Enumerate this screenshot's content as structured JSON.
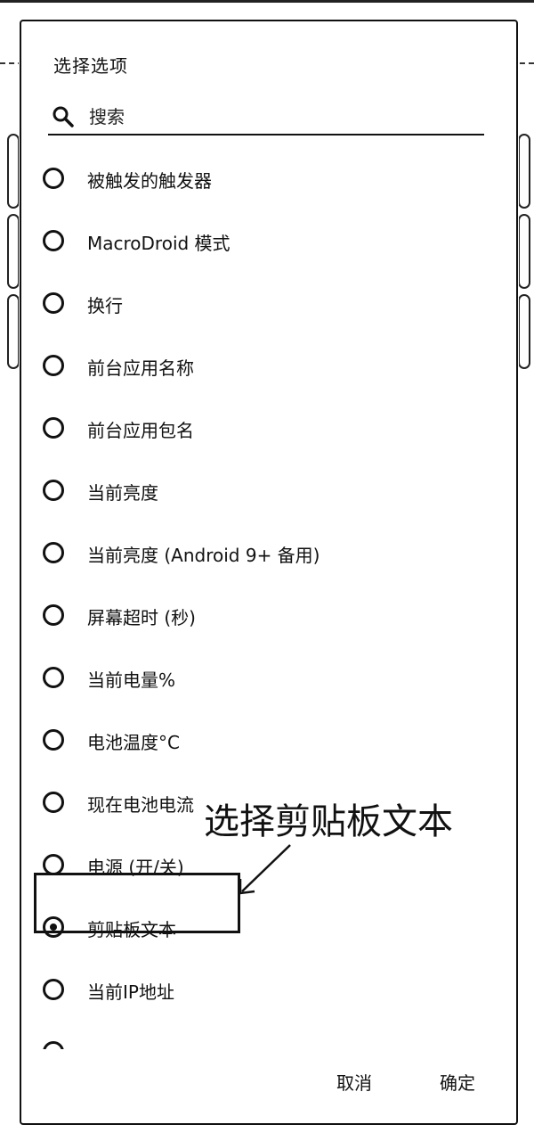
{
  "dialog": {
    "title": "选择选项",
    "search_placeholder": "搜索"
  },
  "options": [
    {
      "label": "被触发的触发器",
      "selected": false
    },
    {
      "label": "MacroDroid 模式",
      "selected": false
    },
    {
      "label": "换行",
      "selected": false
    },
    {
      "label": "前台应用名称",
      "selected": false
    },
    {
      "label": "前台应用包名",
      "selected": false
    },
    {
      "label": "当前亮度",
      "selected": false
    },
    {
      "label": "当前亮度 (Android 9+ 备用)",
      "selected": false
    },
    {
      "label": "屏幕超时 (秒)",
      "selected": false
    },
    {
      "label": "当前电量%",
      "selected": false
    },
    {
      "label": "电池温度°C",
      "selected": false
    },
    {
      "label": "现在电池电流",
      "selected": false
    },
    {
      "label": "电源 (开/关)",
      "selected": false
    },
    {
      "label": "剪贴板文本",
      "selected": true
    },
    {
      "label": "当前IP地址",
      "selected": false
    }
  ],
  "annotation": {
    "text": "选择剪贴板文本"
  },
  "actions": {
    "cancel": "取消",
    "ok": "确定"
  }
}
